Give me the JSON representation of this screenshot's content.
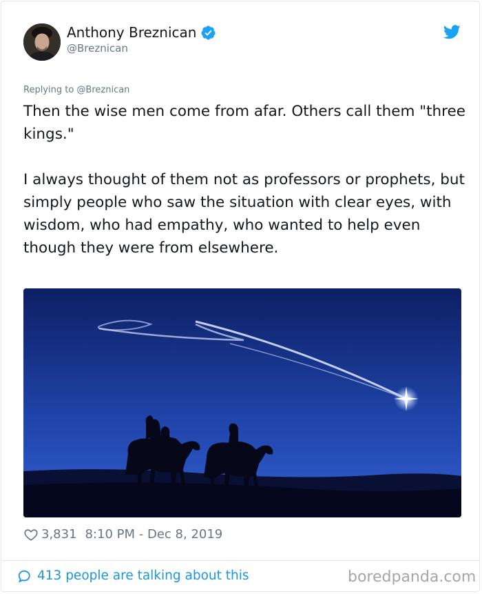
{
  "tweet": {
    "author_name": "Anthony Breznican",
    "author_handle": "@Breznican",
    "replying_to": "Replying to @Breznican",
    "paragraphs": [
      "Then the wise men come from afar. Others call them \"three kings.\"",
      "I always thought of them not as professors or prophets, but simply people who saw the situation with clear eyes, with wisdom, who had empathy, who wanted to help even though they were from elsewhere."
    ],
    "like_count": "3,831",
    "timestamp": "8:10 PM - Dec 8, 2019",
    "talking_text": "413 people are talking about this"
  },
  "watermark": "boredpanda.com",
  "colors": {
    "twitter_blue": "#1da1f2",
    "link_blue": "#1b95e0",
    "secondary_text": "#657786",
    "border": "#e1e8ed"
  },
  "icons": {
    "verified": "verified-badge-icon",
    "logo": "twitter-bird-icon",
    "like": "heart-outline-icon",
    "conversation": "speech-bubble-icon"
  }
}
